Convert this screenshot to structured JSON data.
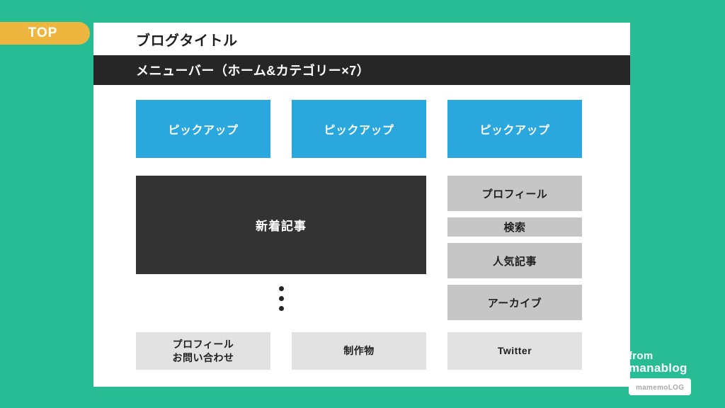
{
  "page": {
    "background_color": "#28bc94"
  },
  "badge": {
    "label": "TOP",
    "color": "#efb63f"
  },
  "panel": {
    "header": {
      "title": "ブログタイトル"
    },
    "menu_bar": {
      "label": "メニューバー（ホーム&カテゴリー×7）",
      "color": "#262626"
    },
    "pickup": {
      "color": "#2aa7dd",
      "items": [
        {
          "label": "ピックアップ"
        },
        {
          "label": "ピックアップ"
        },
        {
          "label": "ピックアップ"
        }
      ]
    },
    "main": {
      "new_posts_label": "新着記事",
      "new_posts_color": "#333333",
      "ellipsis_dots": 3
    },
    "sidebar": {
      "color": "#c6c6c6",
      "items": [
        {
          "label": "プロフィール",
          "size": "lg"
        },
        {
          "label": "検索",
          "size": "sm"
        },
        {
          "label": "人気記事",
          "size": "lg"
        },
        {
          "label": "アーカイブ",
          "size": "lg"
        }
      ]
    },
    "bottom": {
      "color": "#e2e2e2",
      "items": [
        {
          "line1": "プロフィール",
          "line2": "お問い合わせ"
        },
        {
          "line1": "制作物",
          "line2": ""
        },
        {
          "line1": "Twitter",
          "line2": ""
        }
      ]
    }
  },
  "watermark": {
    "line1": "from",
    "line2": "manablog",
    "pill_label": "mamemoLOG"
  }
}
